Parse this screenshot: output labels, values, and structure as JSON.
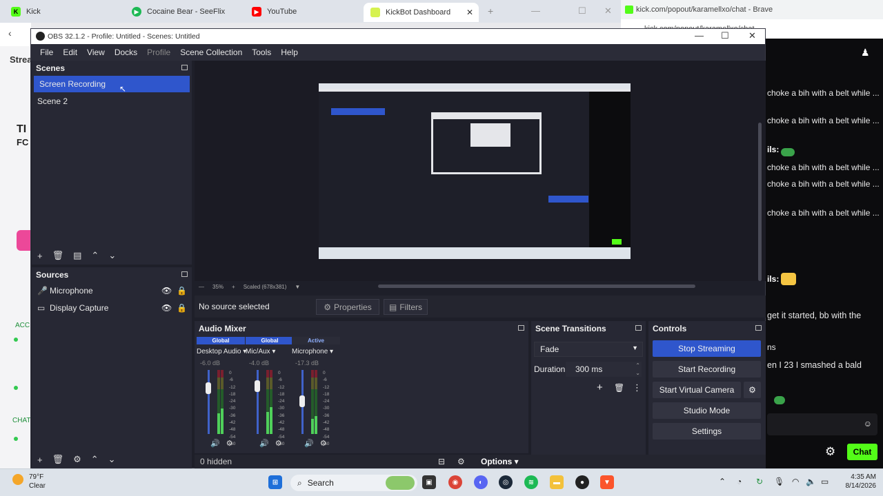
{
  "browser": {
    "tabs": [
      {
        "label": "Kick",
        "color": "#53fc18",
        "glyph": "K"
      },
      {
        "label": "Cocaine Bear - SeeFlix",
        "color": "#1db954",
        "glyph": "▶"
      },
      {
        "label": "YouTube",
        "color": "#ff0000",
        "glyph": "▶"
      },
      {
        "label": "KickBot Dashboard",
        "color": "#d6f250",
        "glyph": "▬"
      }
    ],
    "plus": "+"
  },
  "chat_window": {
    "title": "kick.com/popout/karamellxo/chat - Brave",
    "url": "kick.com/popout/karamellxo/chat",
    "messages": [
      "choke a bih with a belt while ...",
      "choke a bih with a belt while ...",
      "choke a bih with a belt while ...",
      "choke a bih with a belt while ...",
      "choke a bih with a belt while ...",
      "get it started, bb with the",
      "en I 23 I smashed a bald"
    ],
    "labels": [
      "ils:",
      "ils:",
      "ns"
    ],
    "chat_button": "Chat"
  },
  "obs": {
    "title": "OBS 32.1.2 - Profile: Untitled - Scenes: Untitled",
    "menu": [
      "File",
      "Edit",
      "View",
      "Docks",
      "Profile",
      "Scene Collection",
      "Tools",
      "Help"
    ],
    "scenes": {
      "header": "Scenes",
      "items": [
        "Screen Recording",
        "Scene 2"
      ]
    },
    "sources": {
      "header": "Sources",
      "items": [
        "Microphone",
        "Display Capture"
      ]
    },
    "preview": {
      "zoom": "35%",
      "scaled": "Scaled (678x381)"
    },
    "context": {
      "no_source": "No source selected",
      "properties": "Properties",
      "filters": "Filters"
    },
    "audio_mixer": {
      "header": "Audio Mixer",
      "channels": [
        {
          "tag": "Global",
          "name": "Desktop Audio",
          "db": "-6.0 dB",
          "level": 0.72
        },
        {
          "tag": "Global",
          "name": "Mic/Aux",
          "db": "-4.0 dB",
          "level": 0.75
        },
        {
          "tag": "Active",
          "name": "Microphone",
          "db": "-17.3 dB",
          "level": 0.52
        }
      ],
      "ticks": [
        "0",
        "-6",
        "-12",
        "-18",
        "-24",
        "-30",
        "-36",
        "-42",
        "-48",
        "-54",
        "-60"
      ]
    },
    "transitions": {
      "header": "Scene Transitions",
      "selected": "Fade",
      "duration_label": "Duration",
      "duration": "300 ms"
    },
    "controls": {
      "header": "Controls",
      "buttons": [
        "Stop Streaming",
        "Start Recording",
        "Start Virtual Camera",
        "Studio Mode",
        "Settings"
      ]
    },
    "status": {
      "hidden": "0 hidden",
      "options": "Options"
    }
  },
  "taskbar": {
    "weather_temp": "79°F",
    "weather_desc": "Clear",
    "search": "Search",
    "time": "4:35 AM",
    "date": "8/14/2026"
  }
}
